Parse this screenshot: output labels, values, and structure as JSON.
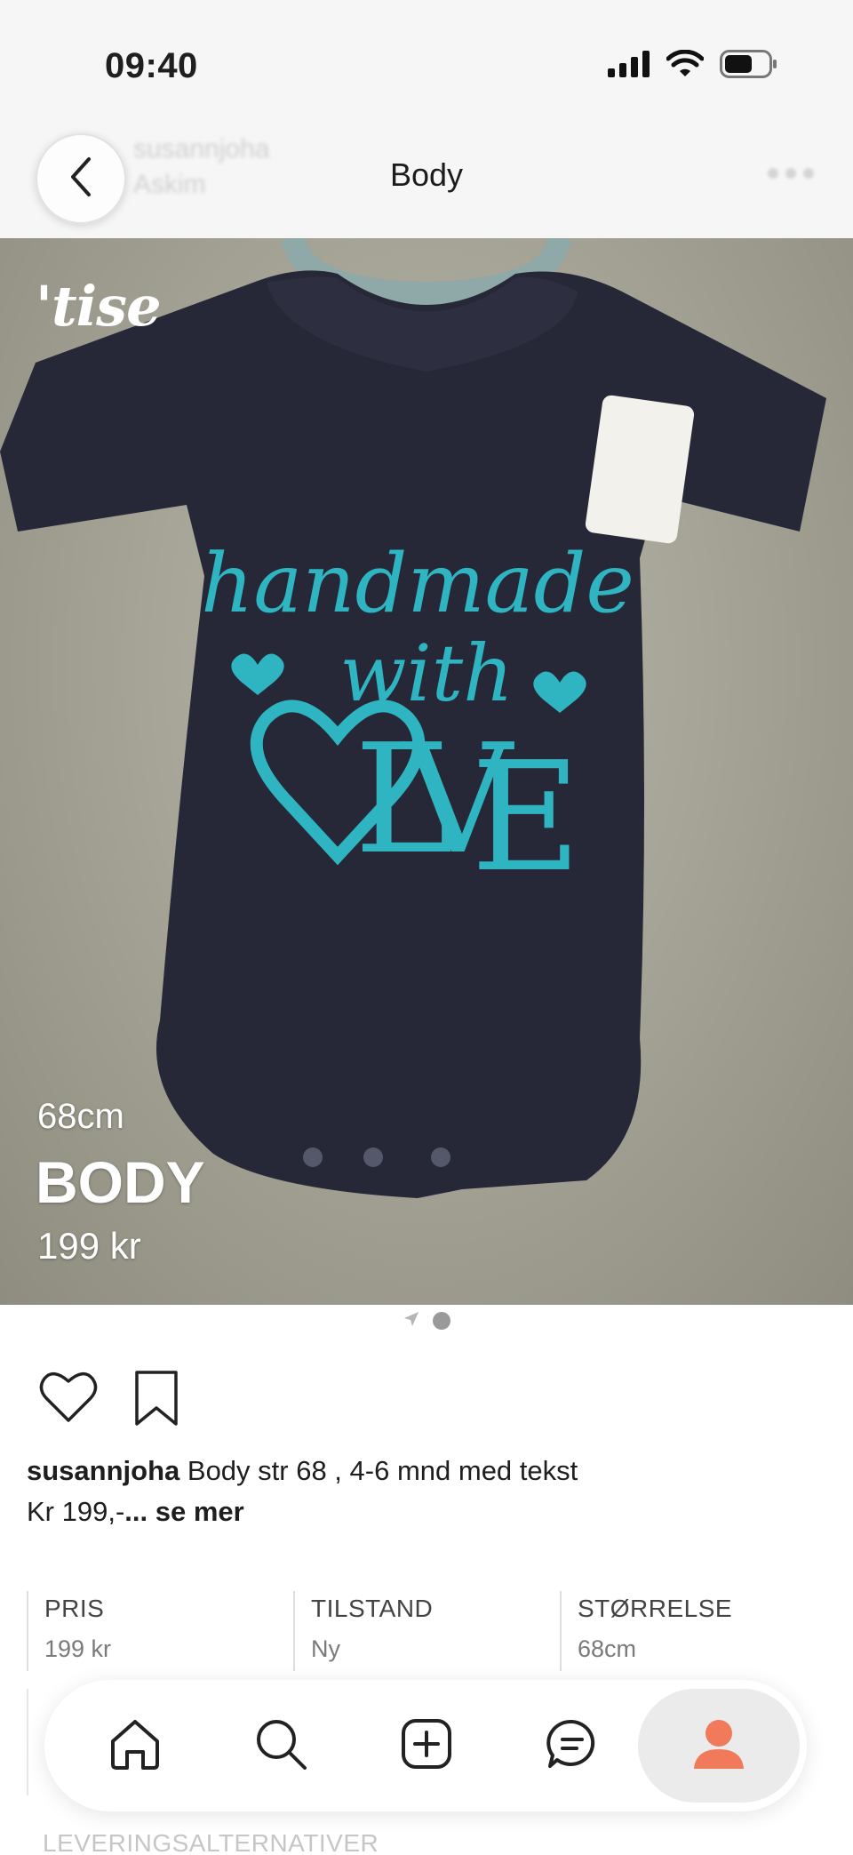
{
  "status_bar": {
    "time": "09:40",
    "icons": [
      "cellular-signal-icon",
      "wifi-icon",
      "battery-icon"
    ]
  },
  "header": {
    "username_blurred": "susannjoha",
    "location_blurred": "Askim",
    "title": "Body",
    "back_icon": "chevron-left-icon",
    "more_icon": "more-dots-icon"
  },
  "hero": {
    "logo": "'tise",
    "size": "68cm",
    "name": "BODY",
    "price": "199 kr"
  },
  "pager": {
    "count": 2,
    "active_index": 1,
    "first_icon": "location-arrow-icon"
  },
  "actions": {
    "like_icon": "heart-icon",
    "save_icon": "bookmark-icon"
  },
  "description": {
    "username": "susannjoha",
    "text": "Body str 68 , 4-6 mnd med tekst",
    "line2": "Kr 199,-",
    "more": "... se mer"
  },
  "details": [
    {
      "label": "PRIS",
      "value": "199 kr"
    },
    {
      "label": "TILSTAND",
      "value": "Ny"
    },
    {
      "label": "STØRRELSE",
      "value": "68cm"
    }
  ],
  "below_fold_label": "LEVERINGSALTERNATIVER",
  "nav": {
    "items": [
      "home-icon",
      "search-icon",
      "add-icon",
      "messages-icon",
      "profile-icon"
    ],
    "active": "profile-icon",
    "accent_color": "#f07a5a"
  },
  "colors": {
    "background": "#ffffff",
    "header_bg": "#f6f6f6",
    "garment": "#262838",
    "print_text": "#2fb4c2",
    "accent": "#f07a5a"
  }
}
